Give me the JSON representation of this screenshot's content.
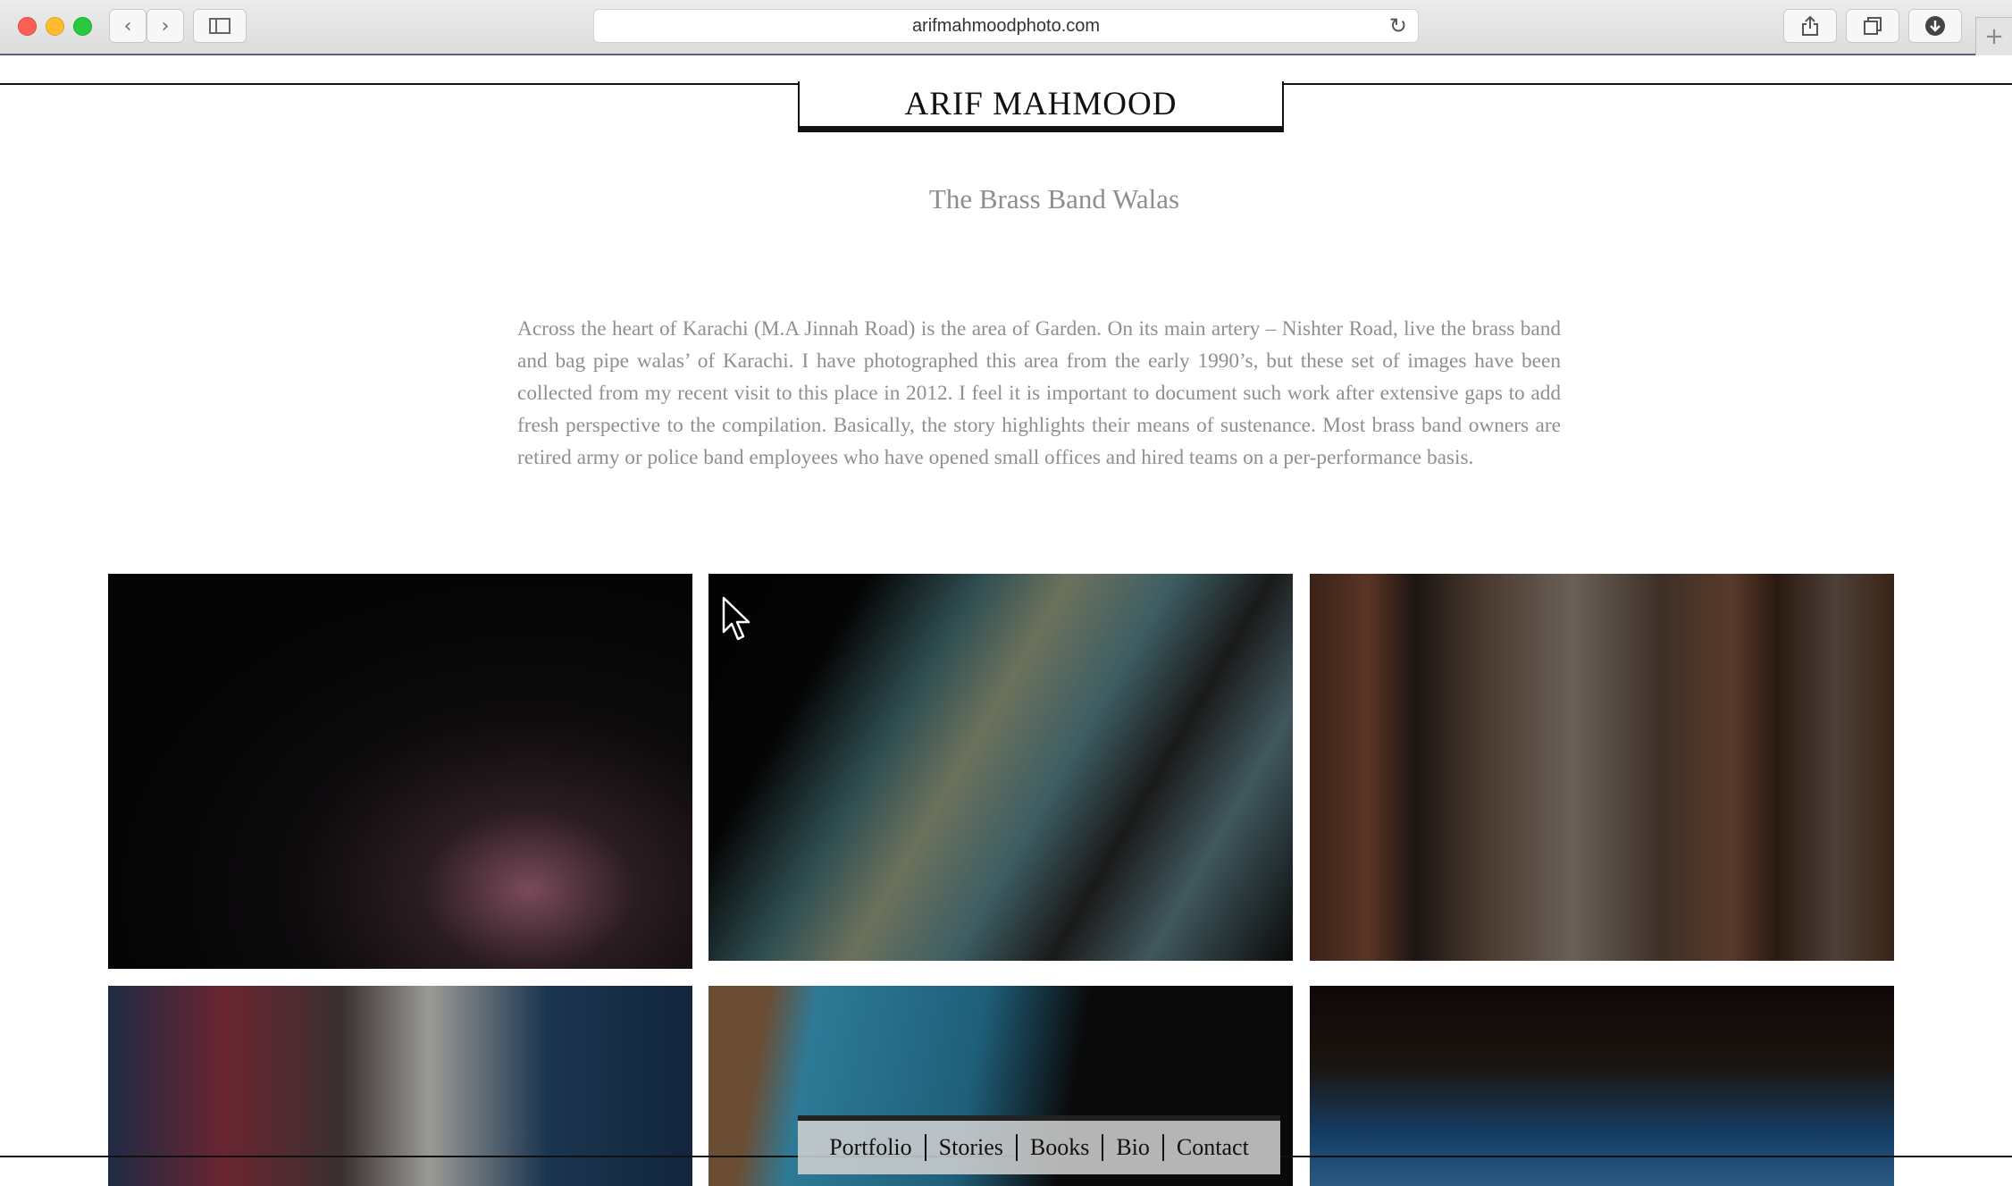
{
  "browser": {
    "url": "arifmahmoodphoto.com",
    "back_icon": "chevron-left",
    "forward_icon": "chevron-right",
    "sidebar_icon": "sidebar",
    "reload_icon": "reload",
    "share_icon": "share",
    "tabs_icon": "tab-overview",
    "download_icon": "download",
    "new_tab_icon": "plus"
  },
  "site": {
    "logo": "ARIF MAHMOOD"
  },
  "story": {
    "title": "The Brass Band Walas",
    "body": "Across the heart of Karachi (M.A Jinnah Road) is the area of Garden. On its main artery – Nishter Road, live the brass band and bag pipe walas’ of Karachi. I have photographed this area from the early 1990’s, but these set of images have been collected from my recent visit to this place in 2012. I feel it is important to document such work after extensive gaps to add fresh perspective to the compilation. Basically, the story highlights their means of sustenance. Most brass band owners are retired army or police band employees who have opened small offices and hired teams on a per-performance basis."
  },
  "nav": {
    "items": [
      "Portfolio",
      "Stories",
      "Books",
      "Bio",
      "Contact"
    ]
  },
  "colors": {
    "chrome_bg": "#dcdcdc",
    "text_gray": "#8f8f8f",
    "ink": "#111111"
  }
}
